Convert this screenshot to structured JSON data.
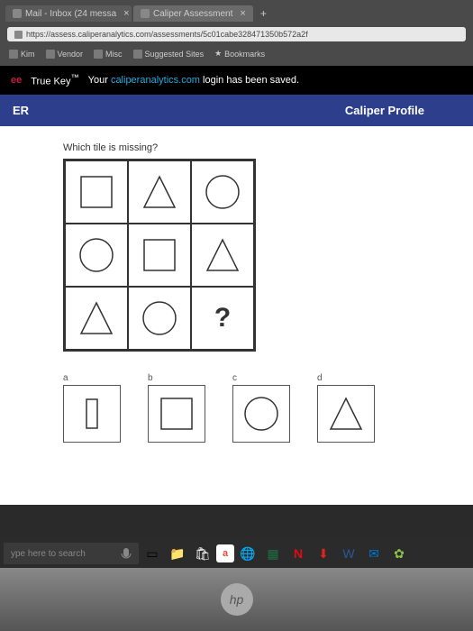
{
  "tabs": [
    {
      "label": "Mail - Inbox (24 messa"
    },
    {
      "label": "Caliper Assessment"
    }
  ],
  "url": "https://assess.caliperanalytics.com/assessments/5c01cabe328471350b572a2f",
  "bookmarks": {
    "items": [
      "Kim",
      "Vendor",
      "Misc",
      "Suggested Sites"
    ],
    "bookmarks_label": "Bookmarks"
  },
  "truekey": {
    "logo_ee": "ee",
    "brand": "True Key",
    "tm": "™",
    "prefix": "Your ",
    "link": "caliperanalytics.com",
    "suffix": " login has been saved."
  },
  "header": {
    "left": "ER",
    "right": "Caliper Profile"
  },
  "question": "Which tile is missing?",
  "grid": {
    "cells": [
      "square",
      "triangle",
      "circle",
      "circle",
      "square",
      "triangle",
      "triangle",
      "circle",
      "?"
    ]
  },
  "answers": [
    {
      "label": "a",
      "shape": "rectangle"
    },
    {
      "label": "b",
      "shape": "square"
    },
    {
      "label": "c",
      "shape": "circle"
    },
    {
      "label": "d",
      "shape": "triangle"
    }
  ],
  "taskbar": {
    "search_placeholder": "ype here to search"
  },
  "laptop_logo": "hp"
}
